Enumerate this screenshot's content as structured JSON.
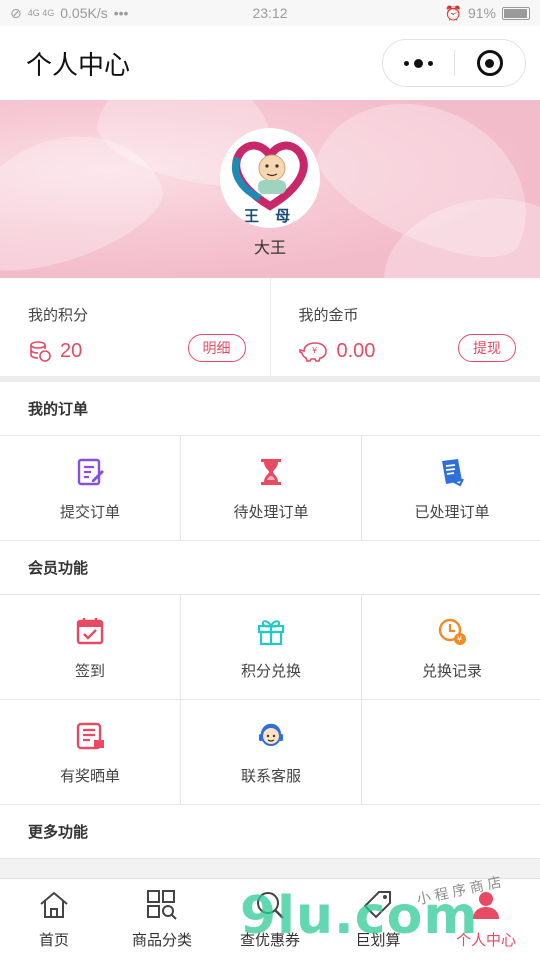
{
  "status": {
    "network": "4G 4G",
    "speed": "0.05K/s",
    "more": "•••",
    "time": "23:12",
    "battery": "91%"
  },
  "header": {
    "title": "个人中心"
  },
  "profile": {
    "name": "大王",
    "logo_text": "王 母"
  },
  "wallet": {
    "points": {
      "label": "我的积分",
      "value": "20",
      "button": "明细"
    },
    "coins": {
      "label": "我的金币",
      "value": "0.00",
      "button": "提现"
    }
  },
  "orders": {
    "title": "我的订单",
    "items": [
      {
        "label": "提交订单",
        "icon": "edit-order-icon"
      },
      {
        "label": "待处理订单",
        "icon": "hourglass-icon"
      },
      {
        "label": "已处理订单",
        "icon": "processed-doc-icon"
      }
    ]
  },
  "member": {
    "title": "会员功能",
    "items": [
      {
        "label": "签到",
        "icon": "calendar-check-icon"
      },
      {
        "label": "积分兑换",
        "icon": "gift-icon"
      },
      {
        "label": "兑换记录",
        "icon": "clock-coin-icon"
      },
      {
        "label": "有奖晒单",
        "icon": "receipt-icon"
      },
      {
        "label": "联系客服",
        "icon": "customer-service-icon"
      }
    ]
  },
  "more": {
    "title": "更多功能"
  },
  "tabs": [
    {
      "label": "首页",
      "icon": "home-icon"
    },
    {
      "label": "商品分类",
      "icon": "category-search-icon"
    },
    {
      "label": "查优惠券",
      "icon": "coupon-search-icon"
    },
    {
      "label": "巨划算",
      "icon": "tag-icon"
    },
    {
      "label": "个人中心",
      "icon": "user-icon",
      "active": true
    }
  ],
  "watermark": {
    "text": "小程序商店",
    "brand": "9lu.com"
  },
  "colors": {
    "accent": "#e84a64",
    "purple": "#8a4de0",
    "teal": "#22c9c9",
    "orange": "#f08a24",
    "blue": "#2e6fd8"
  }
}
